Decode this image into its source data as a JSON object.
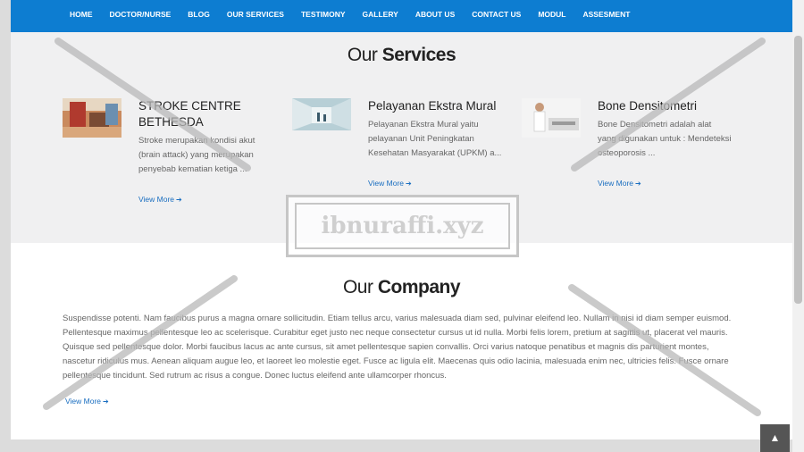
{
  "nav": {
    "items": [
      "HOME",
      "DOCTOR/NURSE",
      "BLOG",
      "OUR SERVICES",
      "TESTIMONY",
      "GALLERY",
      "ABOUT US",
      "CONTACT US",
      "MODUL",
      "ASSESMENT"
    ]
  },
  "services": {
    "title_light": "Our",
    "title_bold": "Services",
    "items": [
      {
        "title": "STROKE CENTRE BETHESDA",
        "desc": "Stroke merupakan kondisi akut (brain attack) yang merupakan penyebab kematian ketiga ...",
        "link": "View More"
      },
      {
        "title": "Pelayanan Ekstra Mural",
        "desc": "Pelayanan Ekstra Mural yaitu pelayanan Unit Peningkatan Kesehatan Masyarakat (UPKM) a...",
        "link": "View More"
      },
      {
        "title": "Bone Densitometri",
        "desc": "Bone Densitometri adalah alat yang digunakan untuk : Mendeteksi osteoporosis ...",
        "link": "View More"
      }
    ]
  },
  "company": {
    "title_light": "Our",
    "title_bold": "Company",
    "text": "Suspendisse potenti. Nam faucibus purus a magna ornare sollicitudin. Etiam tellus arcu, varius malesuada diam sed, pulvinar eleifend leo. Nullam in nisi id diam semper euismod. Pellentesque maximus pellentesque leo ac scelerisque. Curabitur eget justo nec neque consectetur cursus ut id nulla. Morbi felis lorem, pretium at sagittis ut, placerat vel mauris. Quisque sed pellentesque dolor. Morbi faucibus lacus ac ante cursus, sit amet pellentesque sapien convallis. Orci varius natoque penatibus et magnis dis parturient montes, nascetur ridiculus mus. Aenean aliquam augue leo, et laoreet leo molestie eget. Fusce ac ligula elit. Maecenas quis odio lacinia, malesuada enim nec, ultricies felis. Fusce ornare pellentesque tincidunt. Sed rutrum ac risus a congue. Donec luctus eleifend ante ullamcorper rhoncus.",
    "link": "View More"
  },
  "watermark": {
    "text": "ibnuraffi.xyz"
  },
  "icons": {
    "arrow": "arrow-right-circle-icon",
    "back_top": "chevron-up-icon"
  },
  "colors": {
    "navbar": "#0d7dd1",
    "link": "#1a6ec0",
    "services_bg": "#f0f0f1"
  }
}
